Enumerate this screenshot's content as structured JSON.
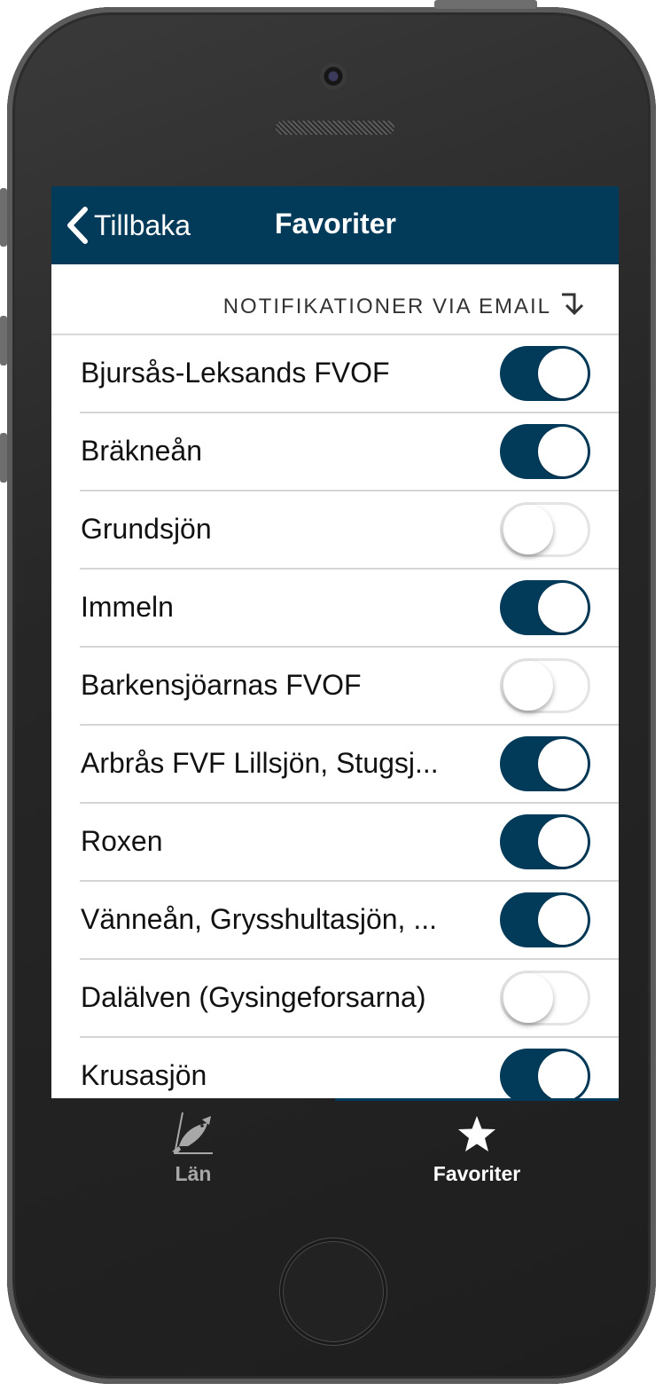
{
  "colors": {
    "navbar_bg": "#023a59",
    "toggle_on": "#023a59",
    "tab_active": "#ffffff",
    "tab_inactive": "#a8a8a8",
    "phone_body": "#262626"
  },
  "navbar": {
    "back_label": "Tillbaka",
    "back_icon": "chevron-left-icon",
    "title": "Favoriter"
  },
  "section": {
    "label": "NOTIFIKATIONER VIA EMAIL",
    "icon": "arrow-turn-down-icon"
  },
  "favorites": [
    {
      "name": "Bjursås-Leksands FVOF",
      "notify": true
    },
    {
      "name": "Bräkneån",
      "notify": true
    },
    {
      "name": "Grundsjön",
      "notify": false
    },
    {
      "name": "Immeln",
      "notify": true
    },
    {
      "name": "Barkensjöarnas FVOF",
      "notify": false
    },
    {
      "name": "Arbrås FVF Lillsjön, Stugsj...",
      "notify": true
    },
    {
      "name": "Roxen",
      "notify": true
    },
    {
      "name": "Vänneån, Grysshultasjön, ...",
      "notify": true
    },
    {
      "name": "Dalälven (Gysingeforsarna)",
      "notify": false
    },
    {
      "name": "Krusasjön",
      "notify": true
    }
  ],
  "tabs": [
    {
      "label": "Län",
      "icon": "fish-icon",
      "active": false
    },
    {
      "label": "Favoriter",
      "icon": "star-icon",
      "active": true
    }
  ]
}
